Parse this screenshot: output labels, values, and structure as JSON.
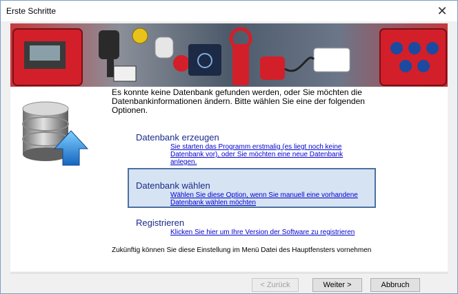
{
  "window": {
    "title": "Erste Schritte",
    "close_glyph": "✕"
  },
  "intro": {
    "text": "Es konnte keine Datenbank gefunden werden, oder Sie möchten die Datenbankinformationen ändern. Bitte wählen Sie eine der folgenden Optionen."
  },
  "options": [
    {
      "title": "Datenbank erzeugen",
      "link": "Sie starten das Programm erstmalig (es liegt noch keine Datenbank vor), oder Sie möchten eine neue Datenbank anlegen."
    },
    {
      "title": "Datenbank wählen",
      "link": "Wählen Sie diese Option, wenn Sie manuell eine vorhandene Datenbank wählen möchten",
      "selected": true
    },
    {
      "title": "Registrieren",
      "link": "Klicken Sie hier um Ihre Version der Software zu registrieren"
    }
  ],
  "footnote": "Zukünftig können Sie diese Einstellung im Menü Datei des Hauptfensters vornehmen",
  "buttons": {
    "back": "< Zurück",
    "next": "Weiter >",
    "cancel": "Abbruch"
  },
  "colors": {
    "selection_fill": "#d6e3f2",
    "selection_border": "#4c6fa0",
    "link": "#0000cc",
    "title": "#1a2a8a",
    "banner_red": "#d21f2a"
  },
  "icons": {
    "database": "database-upload-icon"
  }
}
